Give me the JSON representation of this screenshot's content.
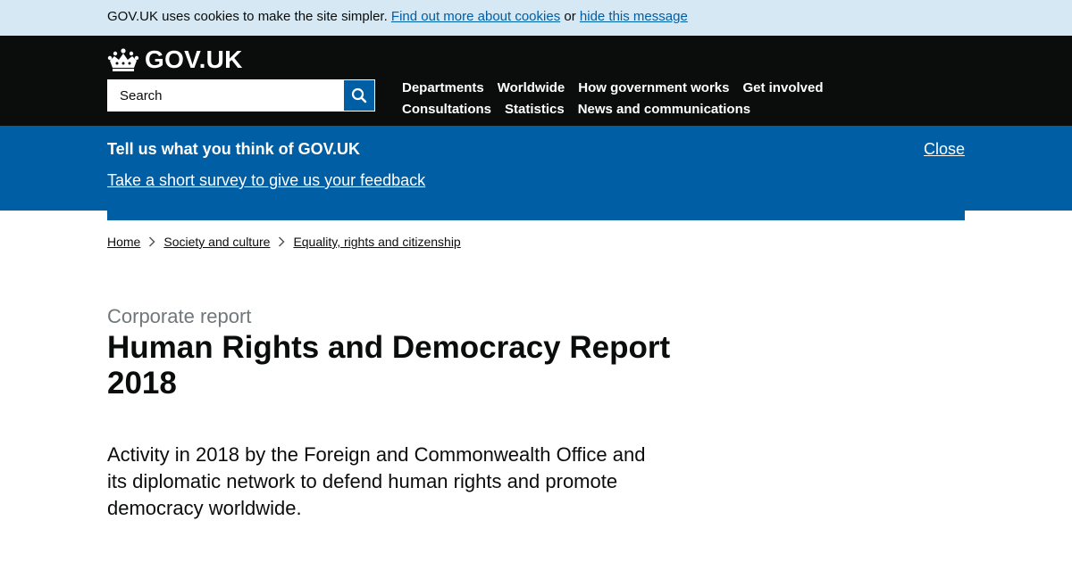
{
  "cookie_banner": {
    "text": "GOV.UK uses cookies to make the site simpler.",
    "find_out_link": "Find out more about cookies",
    "or_text": "or",
    "hide_link": "hide this message"
  },
  "header": {
    "logo_text": "GOV.UK",
    "logo_icon": "crown-icon",
    "search_placeholder": "Search",
    "search_icon": "magnifier-icon",
    "nav_row1": [
      "Departments",
      "Worldwide",
      "How government works",
      "Get involved"
    ],
    "nav_row2": [
      "Consultations",
      "Statistics",
      "News and communications"
    ]
  },
  "survey": {
    "title": "Tell us what you think of GOV.UK",
    "link": "Take a short survey to give us your feedback",
    "close": "Close"
  },
  "breadcrumbs": [
    "Home",
    "Society and culture",
    "Equality, rights and citizenship"
  ],
  "main": {
    "document_type": "Corporate report",
    "title": "Human Rights and Democracy Report 2018",
    "summary": "Activity in 2018 by the Foreign and Commonwealth Office and its diplomatic network to defend human rights and promote democracy worldwide."
  },
  "colors": {
    "brand_blue": "#005ea5",
    "header_black": "#0b0c0c",
    "cookie_bg": "#d5e8f3",
    "secondary_text": "#6f777b"
  }
}
